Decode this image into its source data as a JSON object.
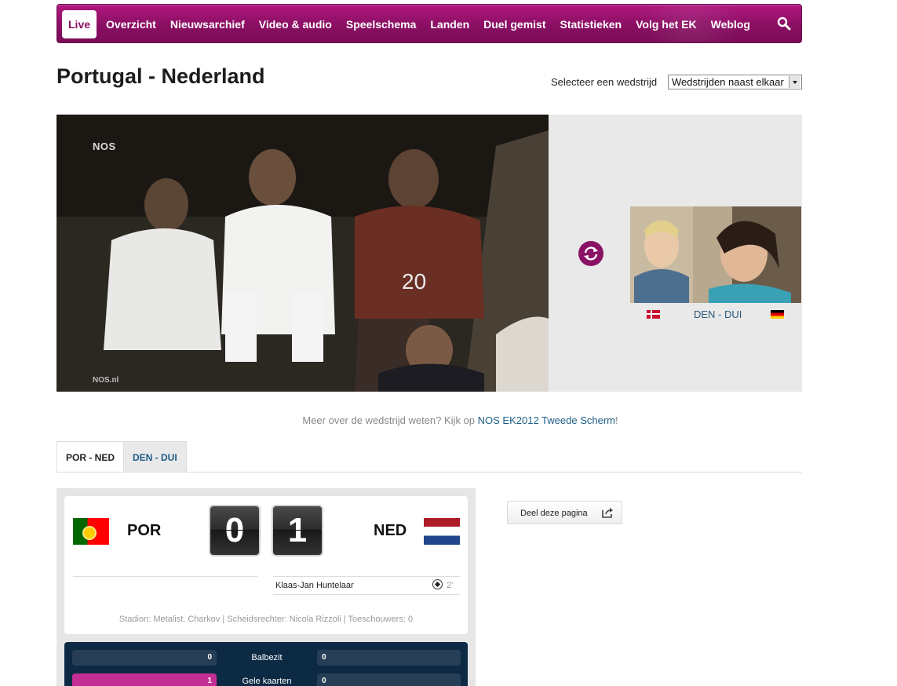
{
  "nav": {
    "items": [
      "Live",
      "Overzicht",
      "Nieuwsarchief",
      "Video & audio",
      "Speelschema",
      "Landen",
      "Duel gemist",
      "Statistieken",
      "Volg het EK",
      "Weblog"
    ],
    "active_index": 0
  },
  "page": {
    "title": "Portugal - Nederland",
    "select_label": "Selecteer een wedstrijd",
    "select_value": "Wedstrijden naast elkaar"
  },
  "video": {
    "watermark": "NOS",
    "watermark_bottom": "NOS.nl"
  },
  "other_match": {
    "label": "DEN - DUI"
  },
  "info": {
    "prefix": "Meer over de wedstrijd weten? Kijk op ",
    "link": "NOS EK2012 Tweede Scherm",
    "suffix": "!"
  },
  "tabs": [
    {
      "label": "POR - NED",
      "active": true
    },
    {
      "label": "DEN - DUI",
      "active": false
    }
  ],
  "match": {
    "home": "POR",
    "away": "NED",
    "home_score": "0",
    "away_score": "1",
    "scorers": [
      {
        "name": "Klaas-Jan Huntelaar",
        "minute": "2'",
        "team": "away"
      }
    ],
    "details": "Stadion: Metalist, Charkov | Scheidsrechter: Nicola Rizzoli | Toeschouwers: 0"
  },
  "stats": [
    {
      "label": "Balbezit",
      "home": "0",
      "away": "0"
    },
    {
      "label": "Gele kaarten",
      "home": "1",
      "away": "0"
    }
  ],
  "share": {
    "label": "Deel deze pagina"
  },
  "colors": {
    "brand": "#8a0f63",
    "link": "#1b5d86",
    "stats_bg": "#0c2a44",
    "stats_highlight": "#c42d93"
  }
}
